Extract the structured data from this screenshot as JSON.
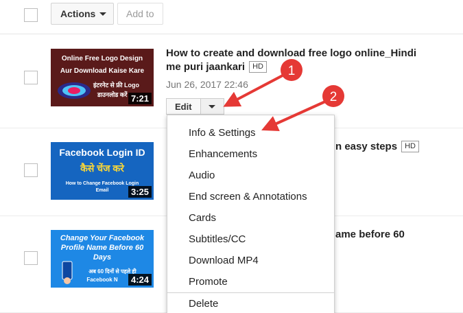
{
  "toolbar": {
    "actions_label": "Actions",
    "add_to_label": "Add to"
  },
  "videos": [
    {
      "title_line1": "How to create and download free logo online_Hindi",
      "title_line2": "me puri jaankari",
      "hd": "HD",
      "date": "Jun 26, 2017 22:46",
      "duration": "7:21",
      "thumb_line1": "Online Free Logo Design",
      "thumb_line2": "Aur Download Kaise Kare",
      "thumb_line3": "इंटरनेट से फ्री Logo",
      "thumb_line4": "डाउनलोड करें"
    },
    {
      "title_visible": "n easy steps",
      "hd": "HD",
      "duration": "3:25",
      "thumb_line1": "Facebook Login ID",
      "thumb_line2": "कैसे चेंज करे",
      "thumb_line3": "How to Change Facebook Login",
      "thumb_line4": "Email"
    },
    {
      "title_visible": "ame before 60",
      "duration": "4:24",
      "thumb_line1": "Change Your Facebook",
      "thumb_line2": "Profile Name Before 60",
      "thumb_line3": "Days",
      "thumb_line4": "अब 60 दिनों से पहले ही",
      "thumb_line5": "Facebook N"
    }
  ],
  "edit": {
    "label": "Edit"
  },
  "menu": {
    "items": [
      "Info & Settings",
      "Enhancements",
      "Audio",
      "End screen & Annotations",
      "Cards",
      "Subtitles/CC",
      "Download MP4",
      "Promote",
      "Delete"
    ]
  },
  "annotations": {
    "marker1": "1",
    "marker2": "2"
  },
  "colors": {
    "annotation_red": "#e53935",
    "thumb1_bg": "#5a1a1a",
    "thumb2_bg": "#1565c0",
    "thumb3_bg": "#1e88e5"
  }
}
